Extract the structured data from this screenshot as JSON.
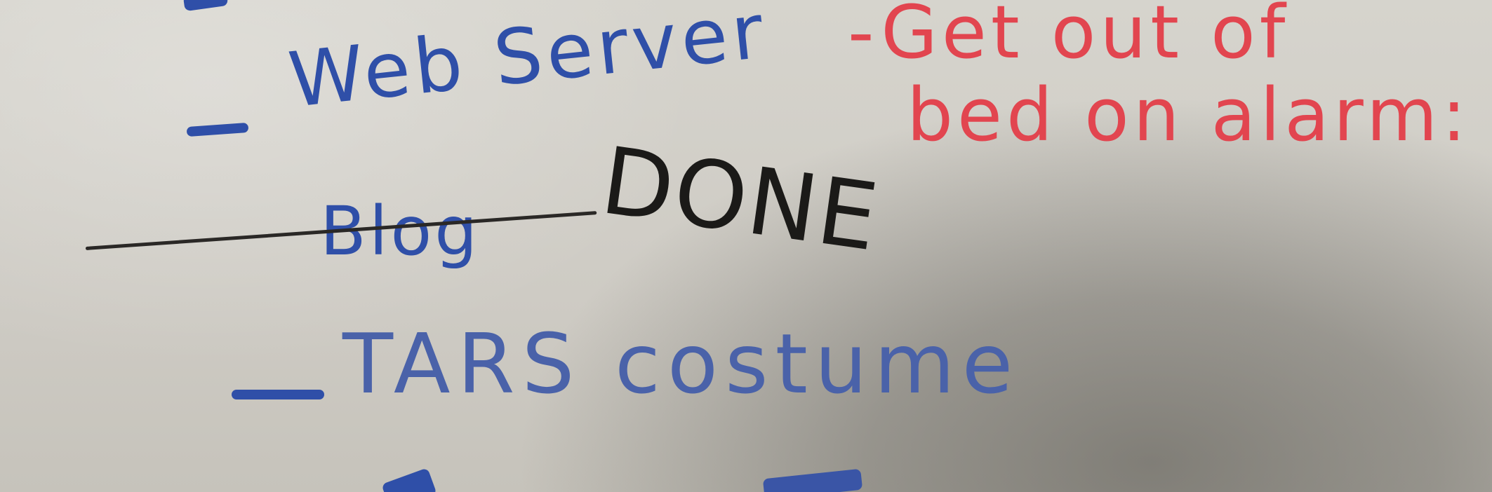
{
  "whiteboard": {
    "items_blue": {
      "web_server": "Web Server",
      "blog": "Blog",
      "tars_costume": "TARS costume"
    },
    "black_note": "DONE",
    "red_note": {
      "line1": "-Get out of",
      "line2": "bed on alarm:"
    },
    "ink_colors": {
      "blue": "#2f4fa8",
      "red": "#e2454f",
      "black": "#1b1a18"
    }
  }
}
